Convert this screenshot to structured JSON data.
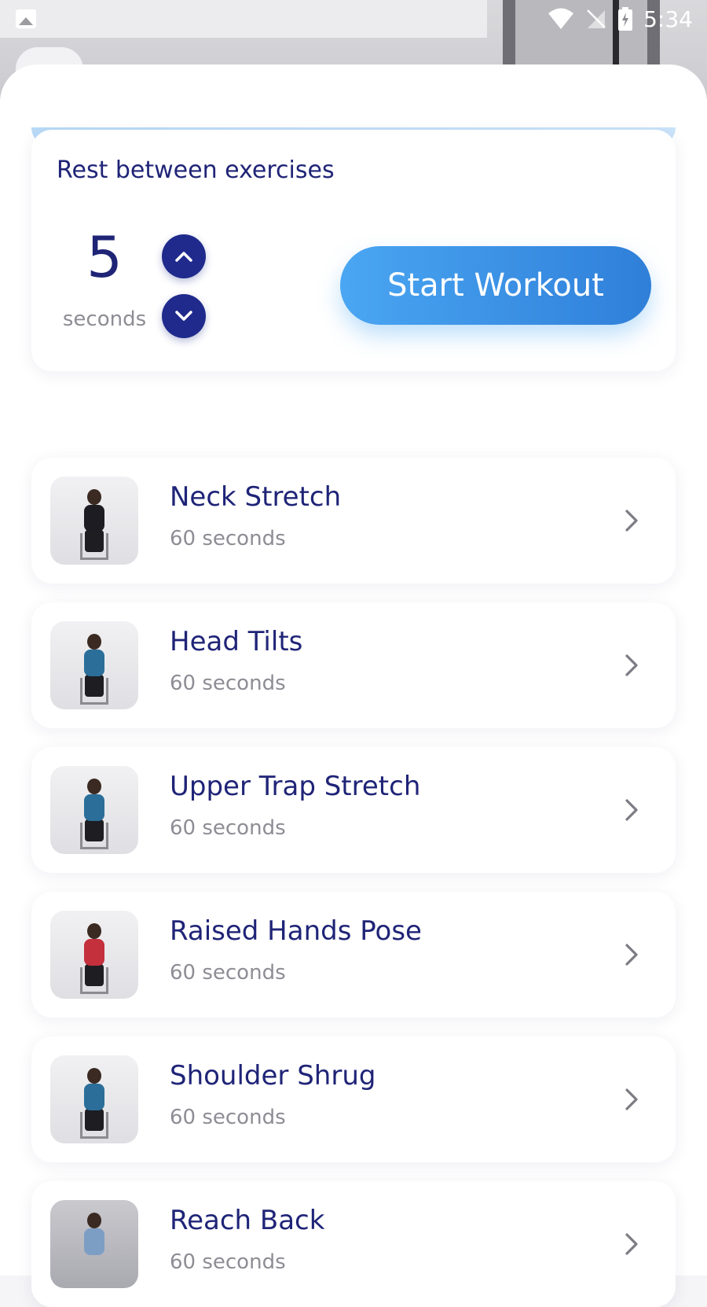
{
  "status_bar": {
    "time": "5:34"
  },
  "rest": {
    "title": "Rest between exercises",
    "value": "5",
    "unit": "seconds"
  },
  "start_label": "Start Workout",
  "colors": {
    "navy": "#1f2477",
    "accent": "#3d95ea",
    "muted": "#8d8d95"
  },
  "exercises": [
    {
      "name": "Neck Stretch",
      "duration": "60 seconds",
      "shirt": "#1c1c22"
    },
    {
      "name": "Head Tilts",
      "duration": "60 seconds",
      "shirt": "#2b6e9a"
    },
    {
      "name": "Upper Trap Stretch",
      "duration": "60 seconds",
      "shirt": "#2b6e9a"
    },
    {
      "name": "Raised Hands Pose",
      "duration": "60 seconds",
      "shirt": "#c4303c"
    },
    {
      "name": "Shoulder Shrug",
      "duration": "60 seconds",
      "shirt": "#2b6e9a"
    },
    {
      "name": "Reach Back",
      "duration": "60 seconds",
      "shirt": "#7d9ec4"
    }
  ]
}
